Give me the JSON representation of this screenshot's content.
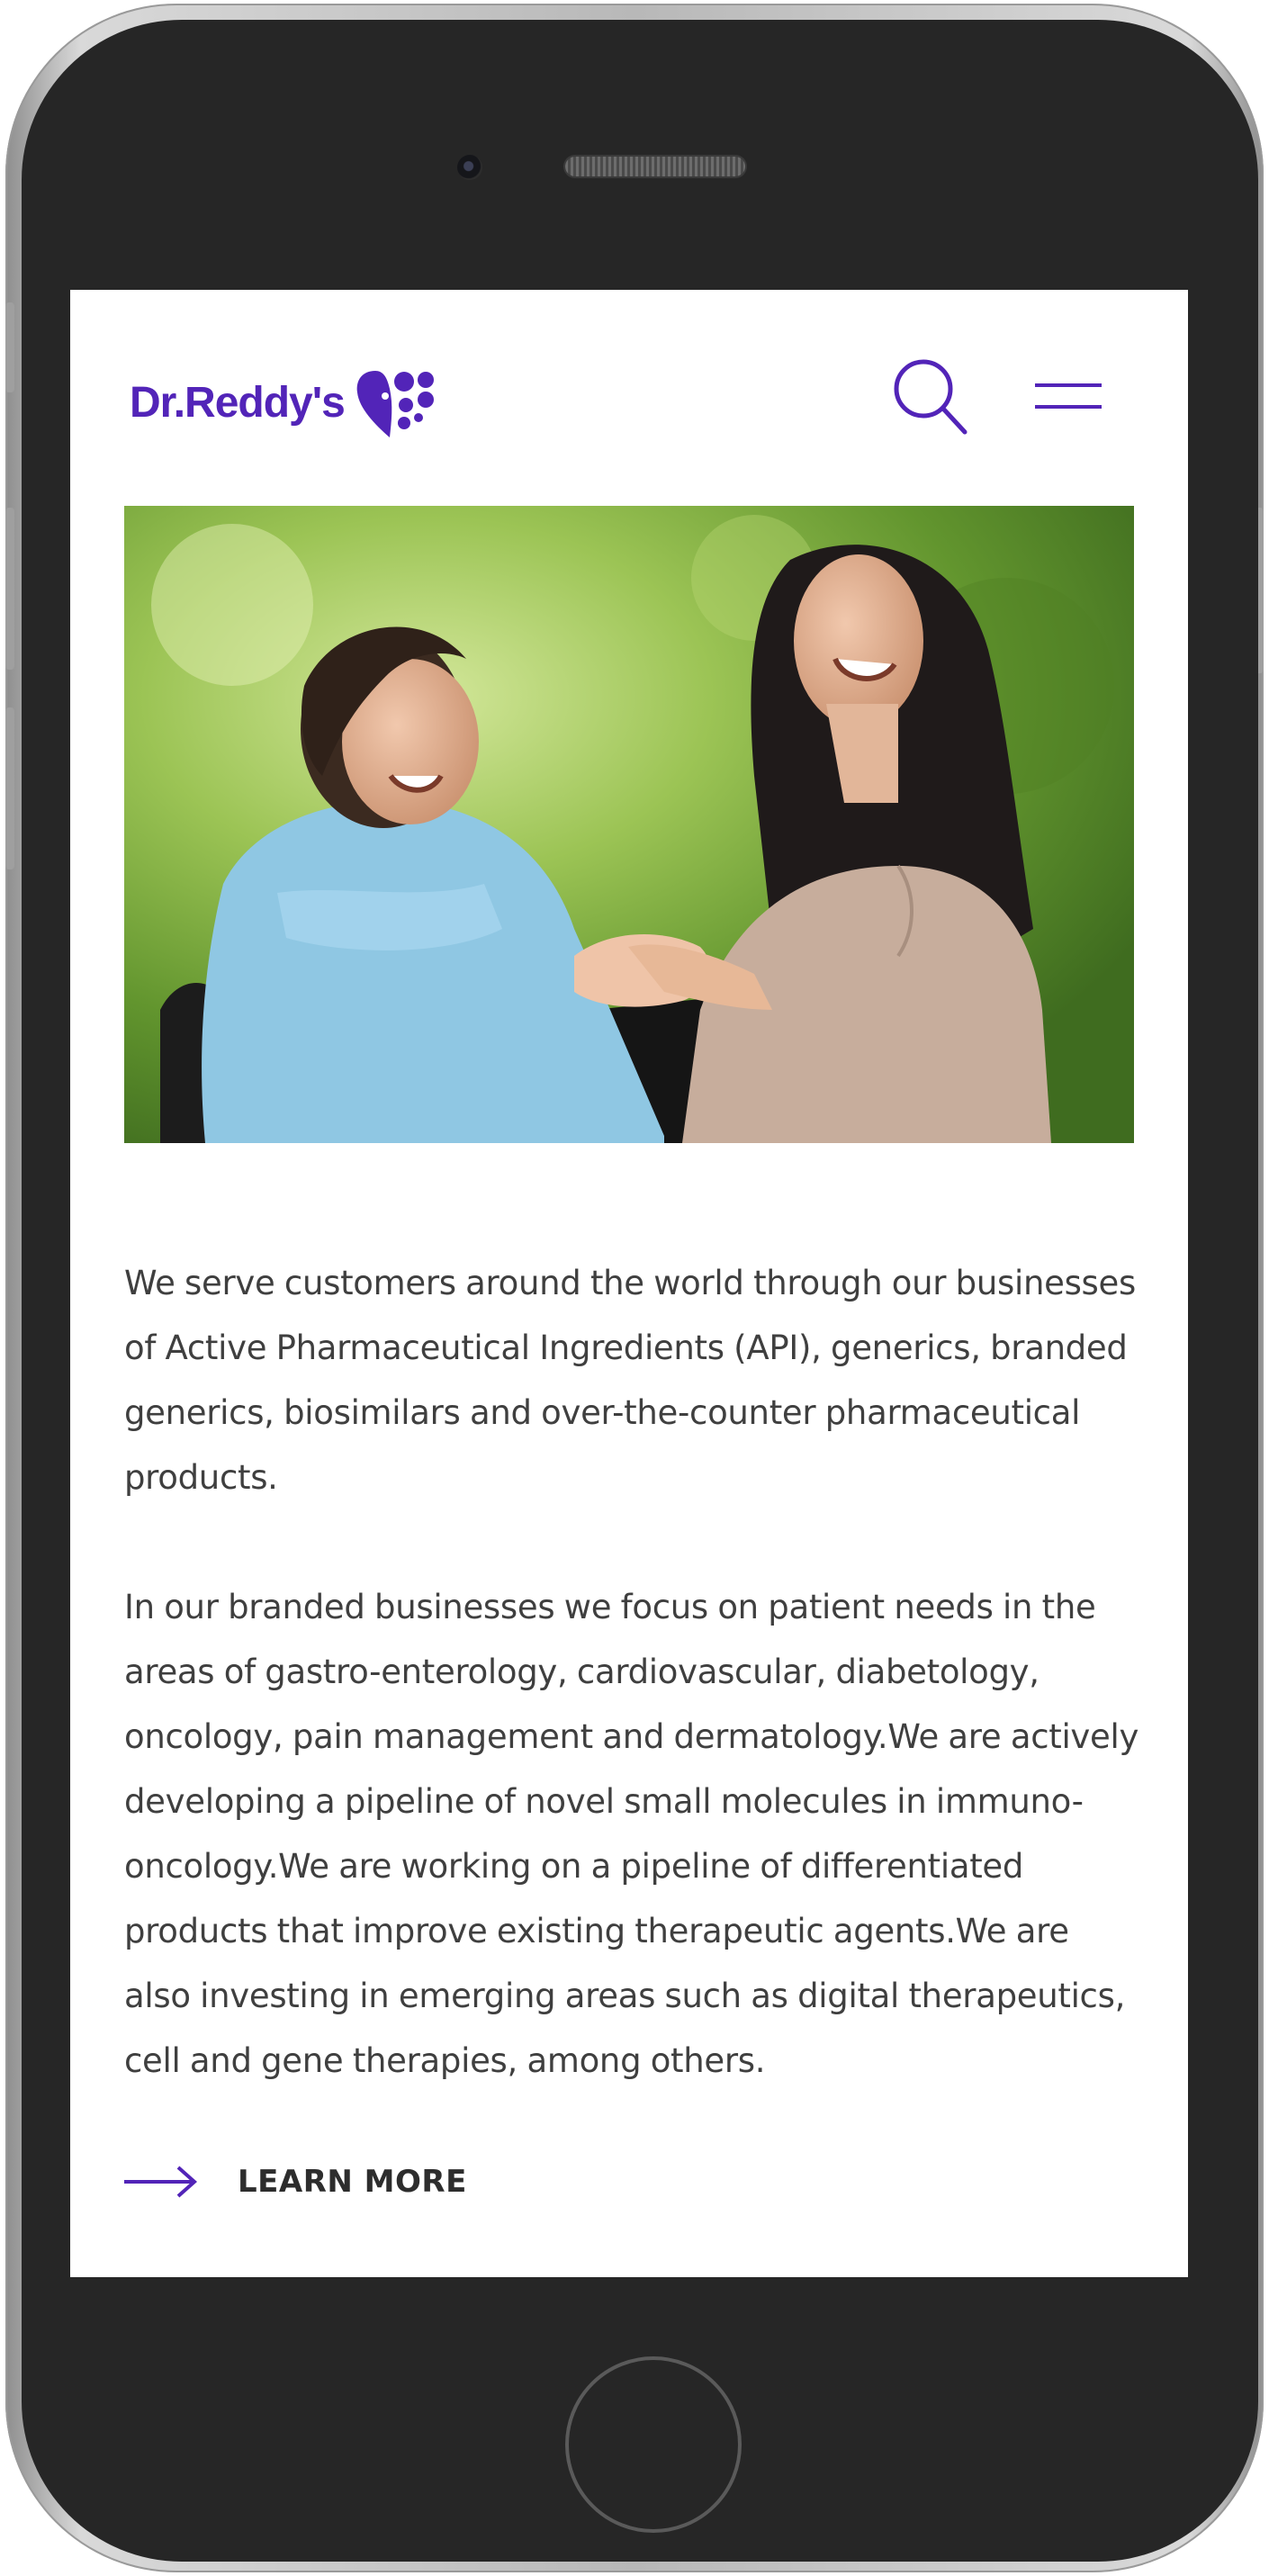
{
  "brand": {
    "name": "Dr.Reddy's",
    "accent_color": "#5224b8"
  },
  "header": {
    "search_icon": "search-icon",
    "menu_icon": "hamburger-menu-icon"
  },
  "hero": {
    "image": "hero-photo"
  },
  "content": {
    "paragraph_1": "We serve customers around the world through our businesses of Active Pharmaceutical Ingredients (API), generics, branded generics, biosimilars and over-the-counter pharmaceutical products.",
    "paragraph_2": "In our branded businesses we focus on patient needs in the areas of gastro-enterology, cardiovascular, diabetology, oncology, pain management and dermatology.We are actively developing a pipeline of novel small molecules in immuno-oncology.We are working on a pipeline of differentiated products that improve existing therapeutic agents.We are also investing in emerging areas such as digital therapeutics, cell and gene therapies, among others."
  },
  "cta": {
    "label": "LEARN MORE",
    "icon": "arrow-right-icon"
  }
}
